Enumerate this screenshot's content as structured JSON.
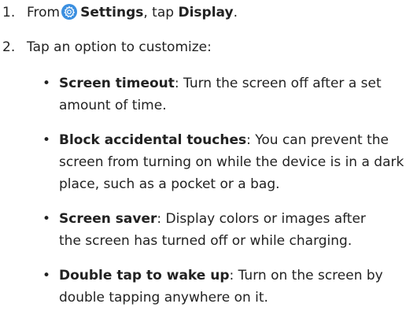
{
  "steps": [
    {
      "num": "1.",
      "pre": "From",
      "settings_label": "Settings",
      "mid": ", tap",
      "target": "Display",
      "end": "."
    },
    {
      "num": "2.",
      "text": "Tap an option to customize:"
    }
  ],
  "options": [
    {
      "term": "Screen timeout",
      "desc_line1": ": Turn the screen off after a set",
      "desc_rest": "amount of time."
    },
    {
      "term": "Block accidental touches",
      "desc_line1": ": You can prevent the",
      "desc_rest": "screen from turning on while the device is in a dark place, such as a pocket or a bag."
    },
    {
      "term": "Screen saver",
      "desc_line1": ": Display colors or images after",
      "desc_rest": "the screen has turned off or while charging."
    },
    {
      "term": "Double tap to wake up",
      "desc_line1": ": Turn on the screen by",
      "desc_rest": "double tapping anywhere on it."
    }
  ],
  "bullet_char": "•",
  "colors": {
    "text": "#222222",
    "settings_icon": "#3b8fe0"
  },
  "icons": {
    "settings": "gear-icon"
  }
}
